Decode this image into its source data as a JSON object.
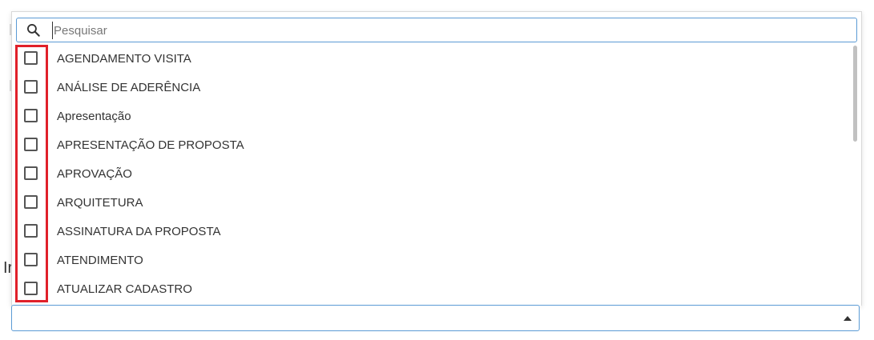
{
  "background": {
    "partial_label": "Ir"
  },
  "dropdown": {
    "search": {
      "placeholder": "Pesquisar",
      "value": ""
    },
    "items": [
      {
        "label": "AGENDAMENTO VISITA",
        "checked": false
      },
      {
        "label": "ANÁLISE DE ADERÊNCIA",
        "checked": false
      },
      {
        "label": "Apresentação",
        "checked": false
      },
      {
        "label": "APRESENTAÇÃO DE PROPOSTA",
        "checked": false
      },
      {
        "label": "APROVAÇÃO",
        "checked": false
      },
      {
        "label": "ARQUITETURA",
        "checked": false
      },
      {
        "label": "ASSINATURA DA PROPOSTA",
        "checked": false
      },
      {
        "label": "ATENDIMENTO",
        "checked": false
      },
      {
        "label": "ATUALIZAR CADASTRO",
        "checked": false
      }
    ]
  },
  "select_field": {
    "value": ""
  },
  "colors": {
    "accent_border": "#5b9bd5",
    "highlight": "#e0202a",
    "text": "#333333"
  }
}
